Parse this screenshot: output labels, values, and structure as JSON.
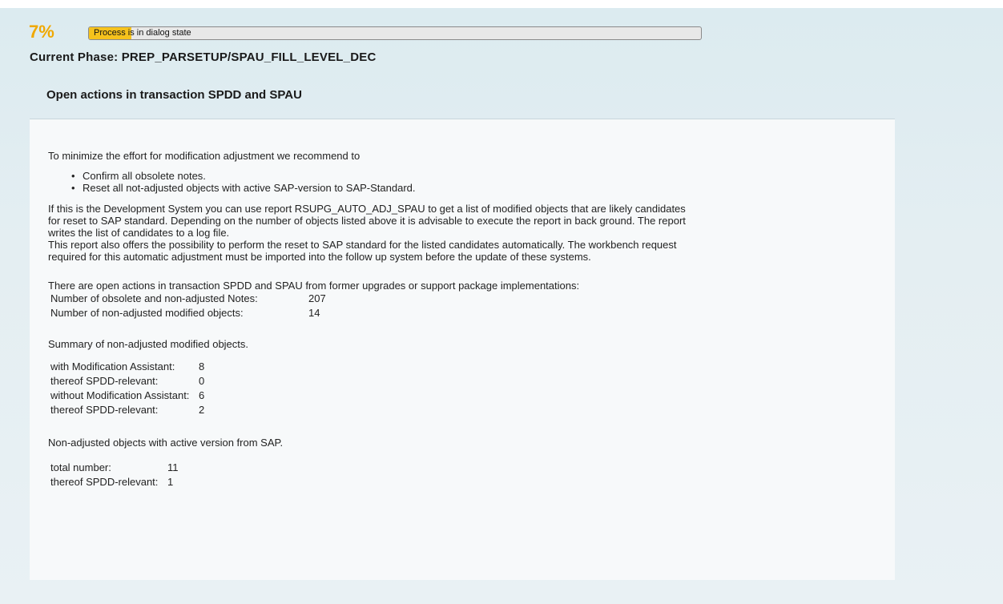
{
  "progress": {
    "percent_label": "7%",
    "fraction": 0.07,
    "status_text": "Process is in dialog state",
    "fill_color": "#f6c21c",
    "percent_color": "#f0a800"
  },
  "phase": {
    "label": "Current Phase: PREP_PARSETUP/SPAU_FILL_LEVEL_DEC"
  },
  "section": {
    "title": "Open actions in transaction SPDD and SPAU"
  },
  "content": {
    "intro": "To minimize the effort for modification adjustment we recommend to",
    "bullets": [
      "Confirm all obsolete notes.",
      "Reset all not-adjusted objects with active SAP-version to SAP-Standard."
    ],
    "paragraph_lines": [
      "If this is the Development System you can use report RSUPG_AUTO_ADJ_SPAU to get a list of modified objects that are likely candidates",
      "for reset to SAP standard. Depending on the number of objects listed above it is advisable to execute the report in back ground. The report",
      "writes the list of candidates to a log file.",
      "This report also offers the possibility to perform the reset to SAP standard for the listed candidates automatically. The workbench request",
      "required for this automatic adjustment must be imported into the follow up system before the update of these systems."
    ],
    "open_actions_text": "There are open actions in transaction SPDD and SPAU from former upgrades or support package implementations:",
    "counts": [
      {
        "label": "Number of obsolete and non-adjusted Notes:",
        "value": "207"
      },
      {
        "label": "Number of non-adjusted modified objects:",
        "value": "14"
      }
    ],
    "summary_title": "Summary of non-adjusted modified objects.",
    "summary": [
      {
        "label": "with Modification Assistant:",
        "value": "8"
      },
      {
        "label": "thereof SPDD-relevant:",
        "value": "0"
      },
      {
        "label": "without Modification Assistant:",
        "value": "6"
      },
      {
        "label": "thereof SPDD-relevant:",
        "value": "2"
      }
    ],
    "active_title": "Non-adjusted objects with active version from SAP.",
    "active": [
      {
        "label": "total number:",
        "value": "11"
      },
      {
        "label": "thereof SPDD-relevant:",
        "value": "1"
      }
    ]
  }
}
